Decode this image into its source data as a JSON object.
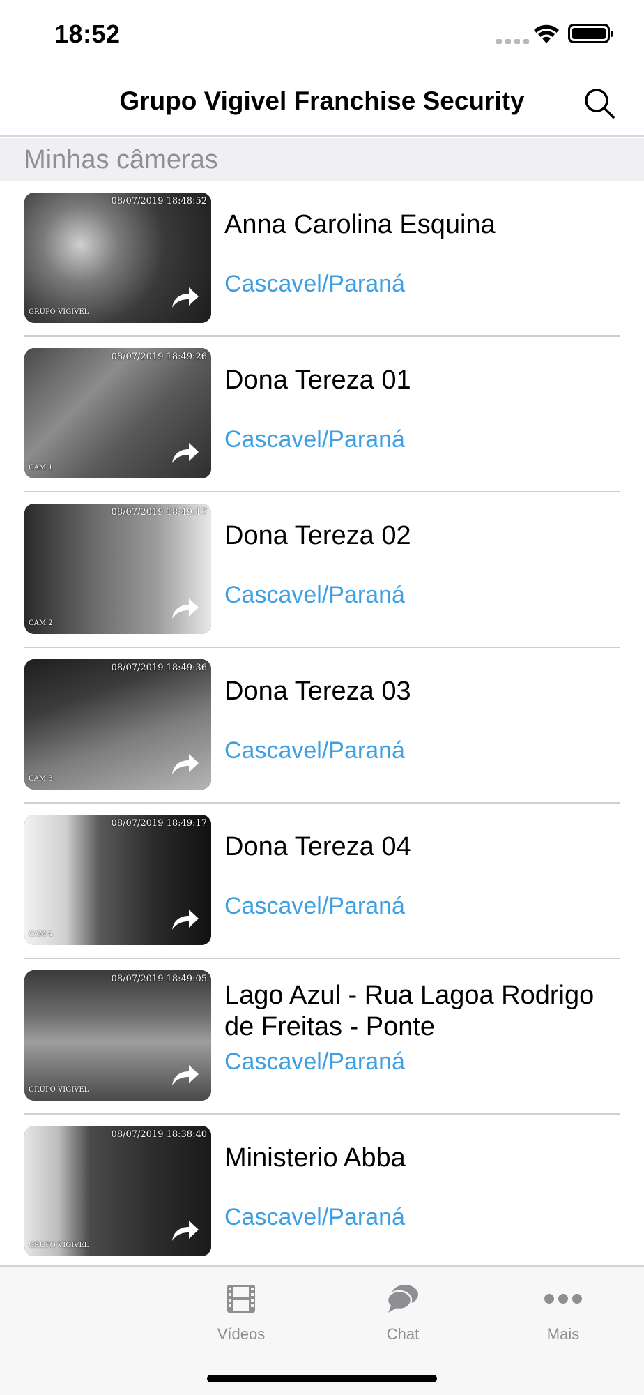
{
  "status_bar": {
    "time": "18:52"
  },
  "nav": {
    "title": "Grupo Vigivel Franchise Security",
    "search_icon": "search-icon"
  },
  "section": {
    "title": "Minhas câmeras"
  },
  "cameras": [
    {
      "title": "Anna Carolina Esquina",
      "location": "Cascavel/Paraná",
      "timestamp": "08/07/2019 18:48:52",
      "cam_label": "GRUPO VIGIVEL"
    },
    {
      "title": "Dona Tereza 01",
      "location": "Cascavel/Paraná",
      "timestamp": "08/07/2019 18:49:26",
      "cam_label": "CAM 1"
    },
    {
      "title": "Dona Tereza 02",
      "location": "Cascavel/Paraná",
      "timestamp": "08/07/2019 18:49:17",
      "cam_label": "CAM 2"
    },
    {
      "title": "Dona Tereza 03",
      "location": "Cascavel/Paraná",
      "timestamp": "08/07/2019 18:49:36",
      "cam_label": "CAM 3"
    },
    {
      "title": "Dona Tereza 04",
      "location": "Cascavel/Paraná",
      "timestamp": "08/07/2019 18:49:17",
      "cam_label": "CAM 4"
    },
    {
      "title": "Lago Azul - Rua Lagoa Rodrigo de Freitas - Ponte",
      "location": "Cascavel/Paraná",
      "timestamp": "08/07/2019 18:49:05",
      "cam_label": "GRUPO VIGIVEL"
    },
    {
      "title": "Ministerio Abba",
      "location": "Cascavel/Paraná",
      "timestamp": "08/07/2019 18:38:40",
      "cam_label": "GRUPO VIGIVEL"
    }
  ],
  "tabs": [
    {
      "label": "Vídeos",
      "icon": "film-icon"
    },
    {
      "label": "Chat",
      "icon": "chat-bubbles-icon"
    },
    {
      "label": "Mais",
      "icon": "more-dots-icon"
    }
  ],
  "colors": {
    "accent": "#3f9fe3",
    "tab_inactive": "#8e8e93",
    "section_bg": "#efeff4"
  }
}
